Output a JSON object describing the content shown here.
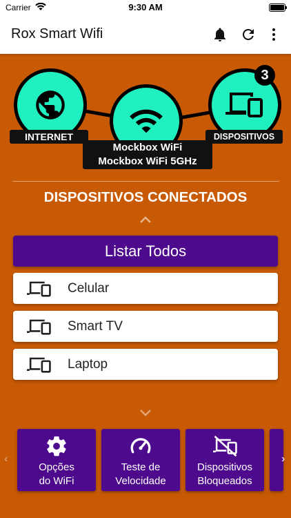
{
  "status": {
    "carrier": "Carrier",
    "time": "9:30 AM"
  },
  "appbar": {
    "title": "Rox Smart Wifi",
    "icons": [
      "bell-icon",
      "refresh-icon",
      "more-vertical-icon"
    ]
  },
  "network": {
    "internet_label": "INTERNET",
    "wifi_names": [
      "Mockbox WiFi",
      "Mockbox WiFi 5GHz"
    ],
    "devices_label": "DISPOSITIVOS",
    "device_count": "3"
  },
  "connected": {
    "title": "DISPOSITIVOS CONECTADOS",
    "list_all": "Listar Todos",
    "devices": [
      {
        "label": "Celular",
        "icon": "devices-icon"
      },
      {
        "label": "Smart TV",
        "icon": "devices-icon"
      },
      {
        "label": "Laptop",
        "icon": "devices-icon"
      }
    ]
  },
  "actions": [
    {
      "label": "Opções\ndo WiFi",
      "icon": "gear-icon"
    },
    {
      "label": "Teste de\nVelocidade",
      "icon": "speedometer-icon"
    },
    {
      "label": "Dispositivos\nBloqueados",
      "icon": "blocked-devices-icon"
    }
  ],
  "colors": {
    "background": "#c95a05",
    "accent": "#4e0a8c",
    "node": "#20f0c0"
  }
}
